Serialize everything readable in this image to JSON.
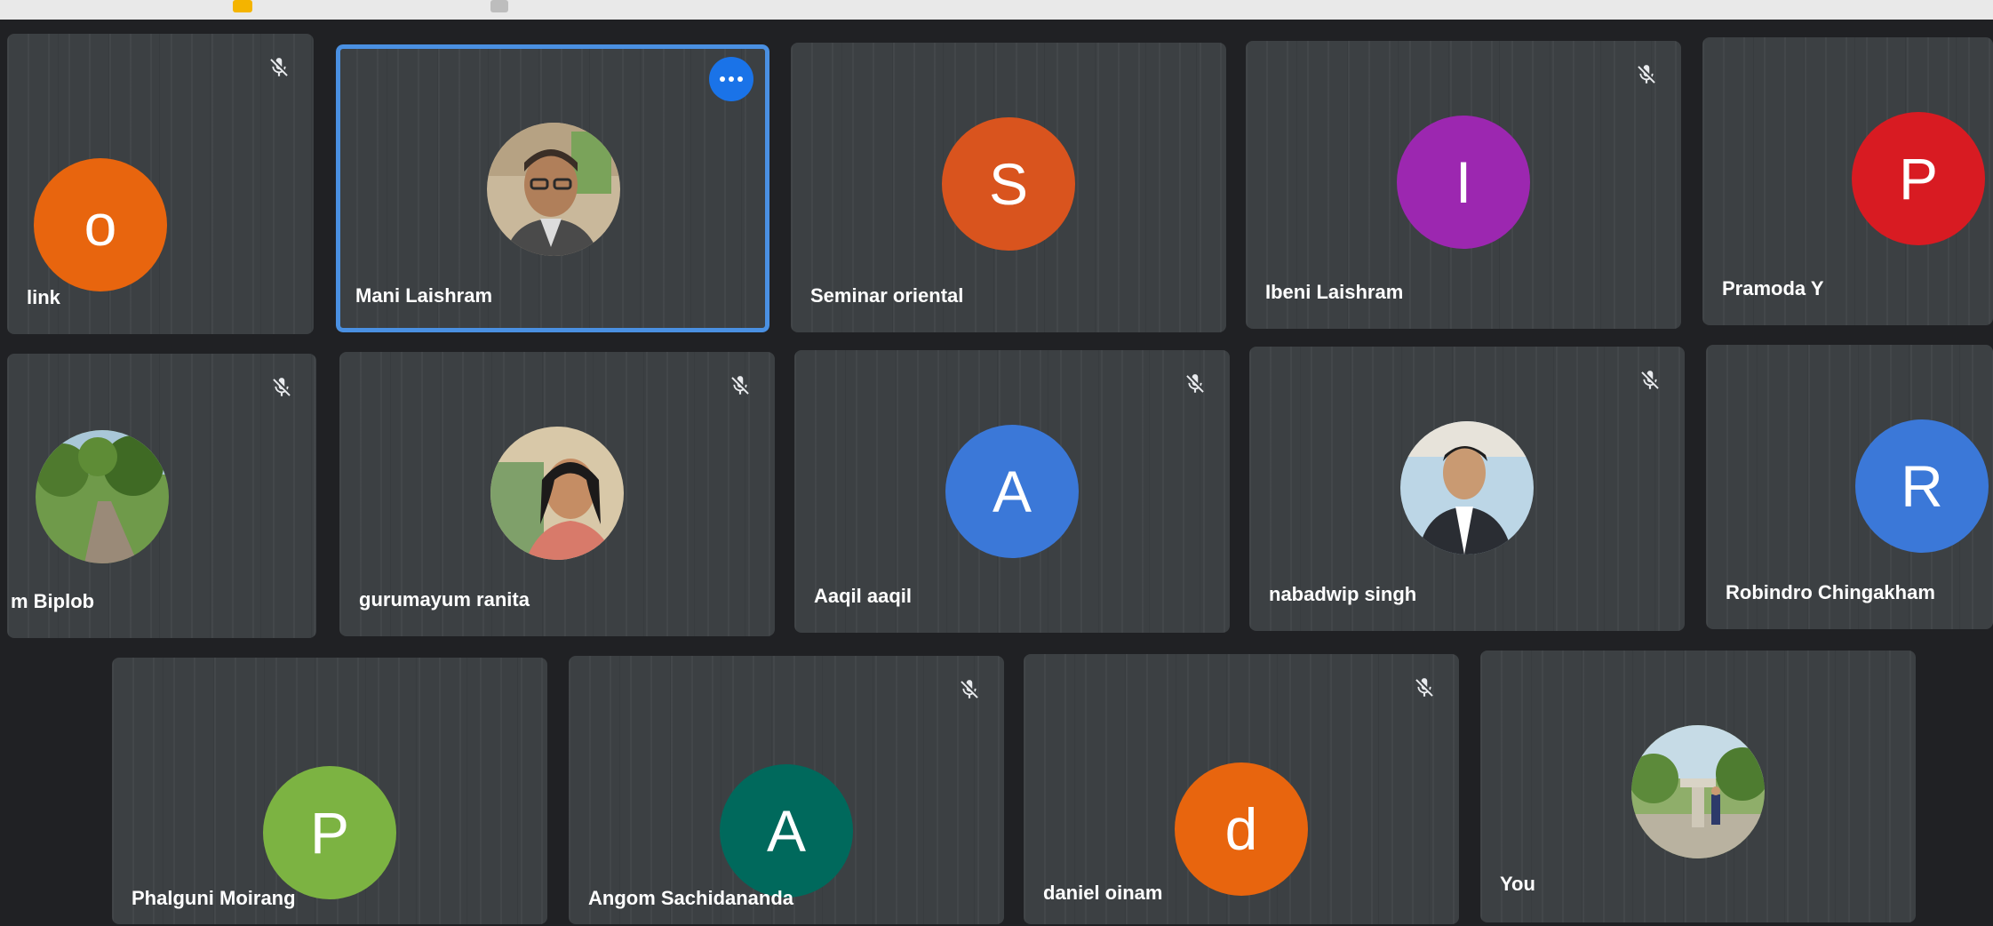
{
  "colors": {
    "page_background": "#202124",
    "tile_background": "#3c4043",
    "active_border": "#4a90e2",
    "more_button": "#1a73e8"
  },
  "participants": [
    {
      "id": "p1",
      "name": "link",
      "avatar_type": "initial",
      "initial": "o",
      "avatar_color": "#e8650e",
      "muted": true,
      "active": false
    },
    {
      "id": "p2",
      "name": "Mani Laishram",
      "avatar_type": "photo",
      "photo": "portrait-man-glasses",
      "muted": false,
      "active": true,
      "more_options_icon": "more-horizontal-icon"
    },
    {
      "id": "p3",
      "name": "Seminar oriental",
      "avatar_type": "initial",
      "initial": "S",
      "avatar_color": "#d9541e",
      "muted": false,
      "active": false
    },
    {
      "id": "p4",
      "name": "Ibeni Laishram",
      "avatar_type": "initial",
      "initial": "I",
      "avatar_color": "#9c27b0",
      "muted": true,
      "active": false
    },
    {
      "id": "p5",
      "name": "Pramoda Y",
      "avatar_type": "initial",
      "initial": "P",
      "avatar_color": "#d81b22",
      "muted": false,
      "active": false
    },
    {
      "id": "p6",
      "name": "m Biplob",
      "avatar_type": "photo",
      "photo": "garden-path",
      "muted": true,
      "active": false
    },
    {
      "id": "p7",
      "name": "gurumayum ranita",
      "avatar_type": "photo",
      "photo": "portrait-woman",
      "muted": true,
      "active": false
    },
    {
      "id": "p8",
      "name": "Aaqil aaqil",
      "avatar_type": "initial",
      "initial": "A",
      "avatar_color": "#3b78d8",
      "muted": true,
      "active": false
    },
    {
      "id": "p9",
      "name": "nabadwip singh",
      "avatar_type": "photo",
      "photo": "portrait-man-suit",
      "muted": true,
      "active": false
    },
    {
      "id": "p10",
      "name": "Robindro Chingakham",
      "avatar_type": "initial",
      "initial": "R",
      "avatar_color": "#3b78d8",
      "muted": false,
      "active": false
    },
    {
      "id": "p11",
      "name": "Phalguni Moirang",
      "avatar_type": "initial",
      "initial": "P",
      "avatar_color": "#7cb342",
      "muted": false,
      "active": false
    },
    {
      "id": "p12",
      "name": "Angom Sachidananda",
      "avatar_type": "initial",
      "initial": "A",
      "avatar_color": "#00695c",
      "muted": true,
      "active": false
    },
    {
      "id": "p13",
      "name": "daniel oinam",
      "avatar_type": "initial",
      "initial": "d",
      "avatar_color": "#e8650e",
      "muted": true,
      "active": false
    },
    {
      "id": "p14",
      "name": "You",
      "avatar_type": "photo",
      "photo": "outdoor-fountain",
      "muted": false,
      "active": false
    }
  ],
  "icons": {
    "mute": "mic-off-icon"
  }
}
